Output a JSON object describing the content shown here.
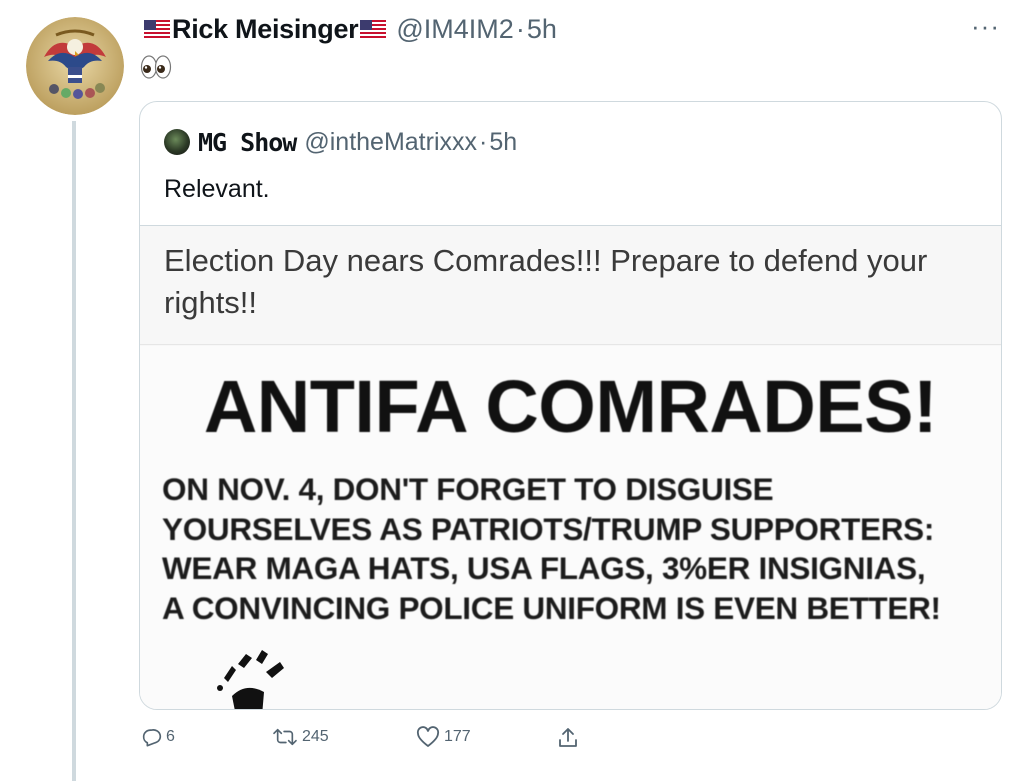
{
  "tweet": {
    "display_name": "Rick Meisinger",
    "handle": "@IM4IM2",
    "separator": "·",
    "time": "5h",
    "more": "···",
    "body_emoji": "👀"
  },
  "quote": {
    "display_name": "MG Show",
    "handle": "@intheMatrixxx",
    "separator": "·",
    "time": "5h",
    "text": "Relevant.",
    "media": {
      "post_text": "Election Day nears Comrades!!! Prepare to defend your rights!!",
      "flyer_title": "ANTIFA COMRADES!",
      "flyer_lines": [
        "ON NOV. 4, DON'T FORGET TO DISGUISE",
        "YOURSELVES AS PATRIOTS/TRUMP SUPPORTERS:",
        "WEAR MAGA HATS, USA FLAGS, 3%ER INSIGNIAS,",
        "A CONVINCING POLICE UNIFORM IS EVEN BETTER!"
      ]
    }
  },
  "actions": {
    "replies": "6",
    "retweets": "245",
    "likes": "177"
  },
  "colors": {
    "text": "#0f1419",
    "secondary": "#536471",
    "border": "#cfd9de"
  }
}
